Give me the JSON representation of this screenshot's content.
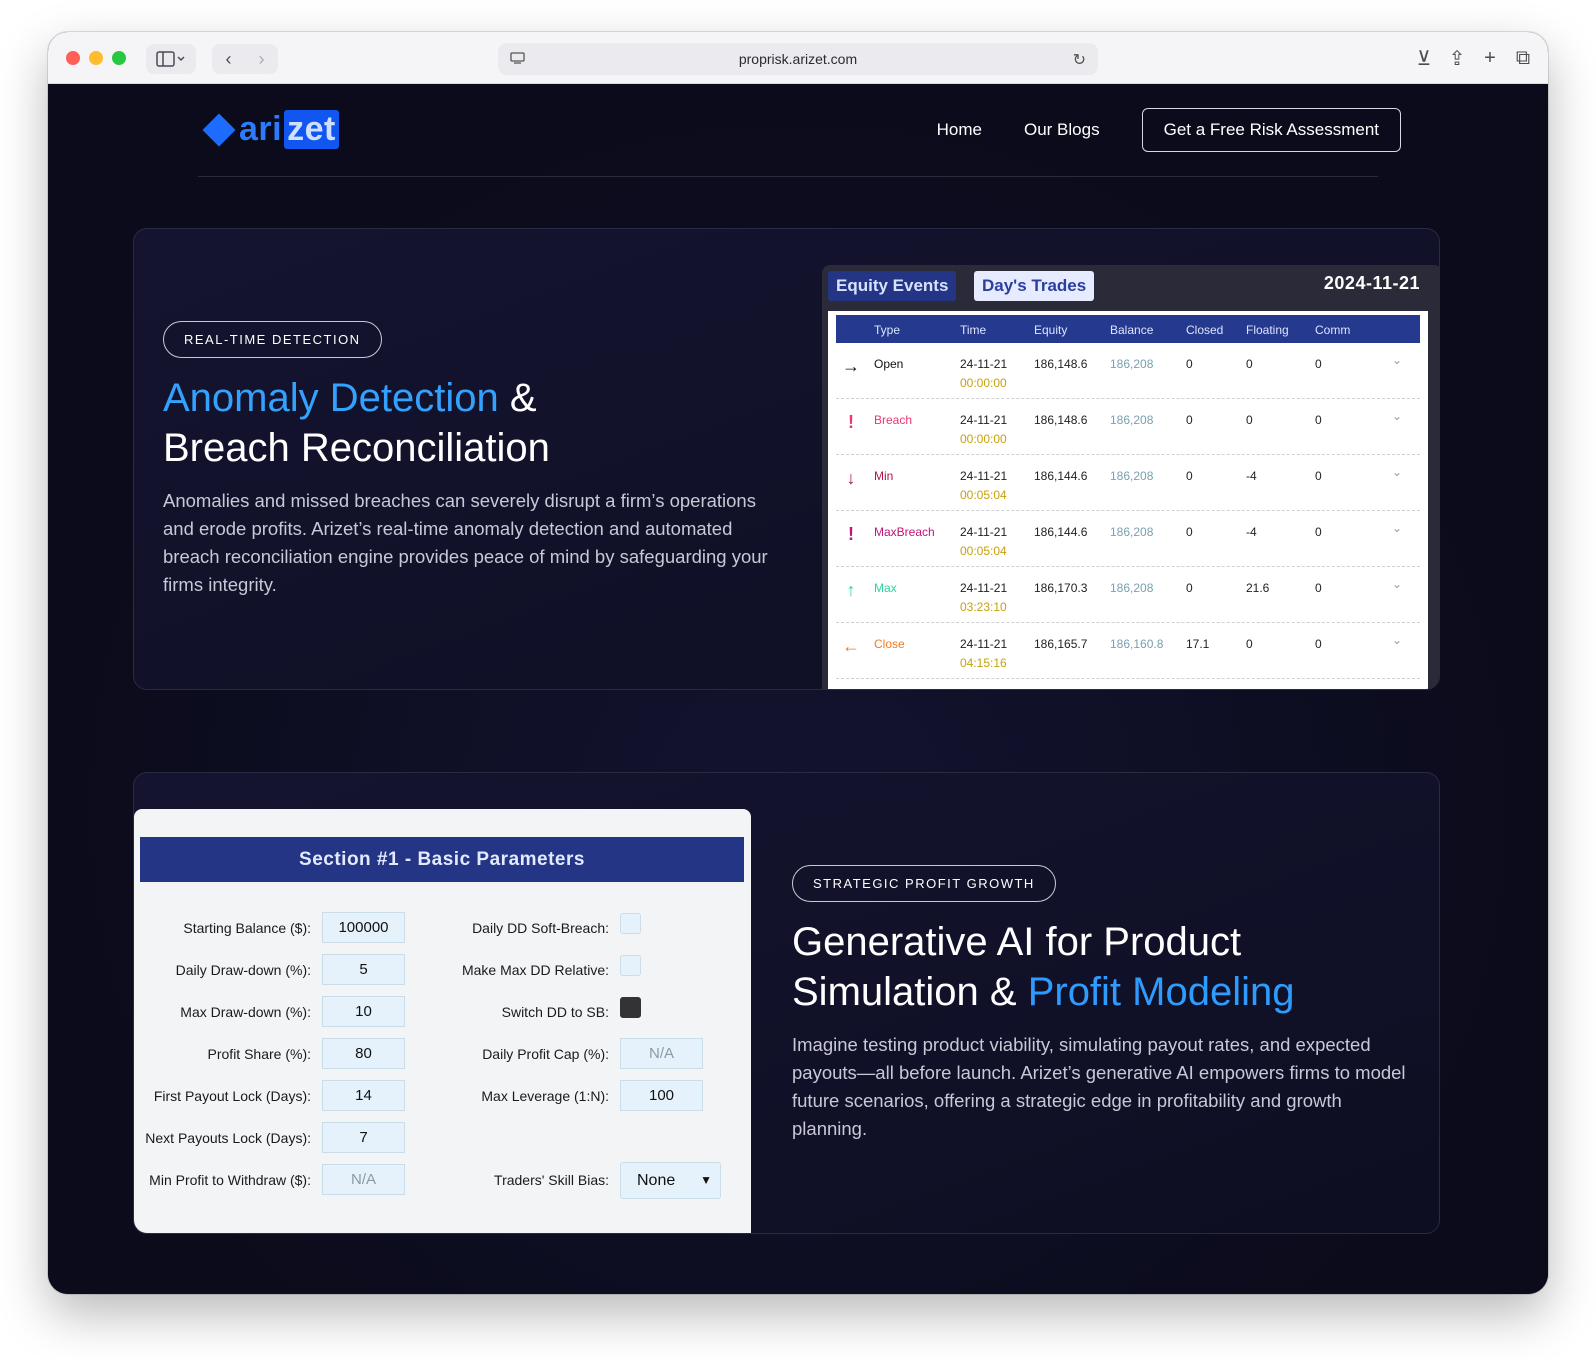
{
  "browser": {
    "url": "proprisk.arizet.com"
  },
  "header": {
    "logo_text": "ari",
    "logo_highlight": "zet",
    "nav": [
      "Home",
      "Our Blogs"
    ],
    "cta_label": "Get a Free Risk Assessment"
  },
  "section1": {
    "pill": "REAL-TIME DETECTION",
    "title_highlight": "Anomaly Detection",
    "title_amp": "&",
    "title_line2": "Breach Reconciliation",
    "description": "Anomalies and missed breaches can severely disrupt a firm’s operations and erode profits. Arizet’s real-time anomaly detection and automated breach reconciliation engine provides peace of mind by safeguarding your firms integrity.",
    "panel": {
      "tab_active": "Equity Events",
      "tab_inactive": "Day's Trades",
      "date": "2024-11-21",
      "columns": [
        "Type",
        "Time",
        "Equity",
        "Balance",
        "Closed",
        "Floating",
        "Comm"
      ],
      "rows": [
        {
          "icon": "arrow-right-icon",
          "glyph": "→",
          "color": "#111111",
          "type": "Open",
          "date": "24-11-21",
          "time": "00:00:00",
          "equity": "186,148.6",
          "balance": "186,208",
          "closed": "0",
          "floating": "0",
          "comm": "0"
        },
        {
          "icon": "alert-circle-icon",
          "glyph": "!",
          "color": "#e8386f",
          "type": "Breach",
          "date": "24-11-21",
          "time": "00:00:00",
          "equity": "186,148.6",
          "balance": "186,208",
          "closed": "0",
          "floating": "0",
          "comm": "0"
        },
        {
          "icon": "arrow-down-icon",
          "glyph": "↓",
          "color": "#b3134e",
          "type": "Min",
          "date": "24-11-21",
          "time": "00:05:04",
          "equity": "186,144.6",
          "balance": "186,208",
          "closed": "0",
          "floating": "-4",
          "comm": "0"
        },
        {
          "icon": "warning-triangle-icon",
          "glyph": "!",
          "color": "#c0147a",
          "type": "MaxBreach",
          "date": "24-11-21",
          "time": "00:05:04",
          "equity": "186,144.6",
          "balance": "186,208",
          "closed": "0",
          "floating": "-4",
          "comm": "0"
        },
        {
          "icon": "arrow-up-icon",
          "glyph": "↑",
          "color": "#2fd3a0",
          "type": "Max",
          "date": "24-11-21",
          "time": "03:23:10",
          "equity": "186,170.3",
          "balance": "186,208",
          "closed": "0",
          "floating": "21.6",
          "comm": "0"
        },
        {
          "icon": "arrow-left-icon",
          "glyph": "←",
          "color": "#f07b22",
          "type": "Close",
          "date": "24-11-21",
          "time": "04:15:16",
          "equity": "186,165.7",
          "balance": "186,160.8",
          "closed": "17.1",
          "floating": "0",
          "comm": "0"
        }
      ]
    }
  },
  "section2": {
    "pill": "STRATEGIC PROFIT GROWTH",
    "title_line1": "Generative AI for Product",
    "title_line2_plain": "Simulation &",
    "title_line2_highlight": "Profit Modeling",
    "description": "Imagine testing product viability, simulating payout rates, and expected payouts—all before launch. Arizet’s generative AI empowers firms to model future scenarios, offering a strategic edge in profitability and growth planning.",
    "params": {
      "title": "Section #1 - Basic Parameters",
      "left": [
        {
          "label": "Starting Balance ($):",
          "value": "100000"
        },
        {
          "label": "Daily Draw-down (%):",
          "value": "5"
        },
        {
          "label": "Max Draw-down (%):",
          "value": "10"
        },
        {
          "label": "Profit Share (%):",
          "value": "80"
        },
        {
          "label": "First Payout Lock (Days):",
          "value": "14"
        },
        {
          "label": "Next Payouts Lock (Days):",
          "value": "7"
        },
        {
          "label": "Min Profit to Withdraw ($):",
          "value": "N/A"
        }
      ],
      "right_checks": [
        {
          "label": "Daily DD Soft-Breach:",
          "checked": false
        },
        {
          "label": "Make Max DD Relative:",
          "checked": false
        },
        {
          "label": "Switch DD to SB:",
          "checked": true
        }
      ],
      "right_inputs": [
        {
          "label": "Daily Profit Cap (%):",
          "value": "N/A"
        },
        {
          "label": "Max Leverage (1:N):",
          "value": "100"
        }
      ],
      "skill_bias_label": "Traders' Skill Bias:",
      "skill_bias_value": "None"
    }
  }
}
